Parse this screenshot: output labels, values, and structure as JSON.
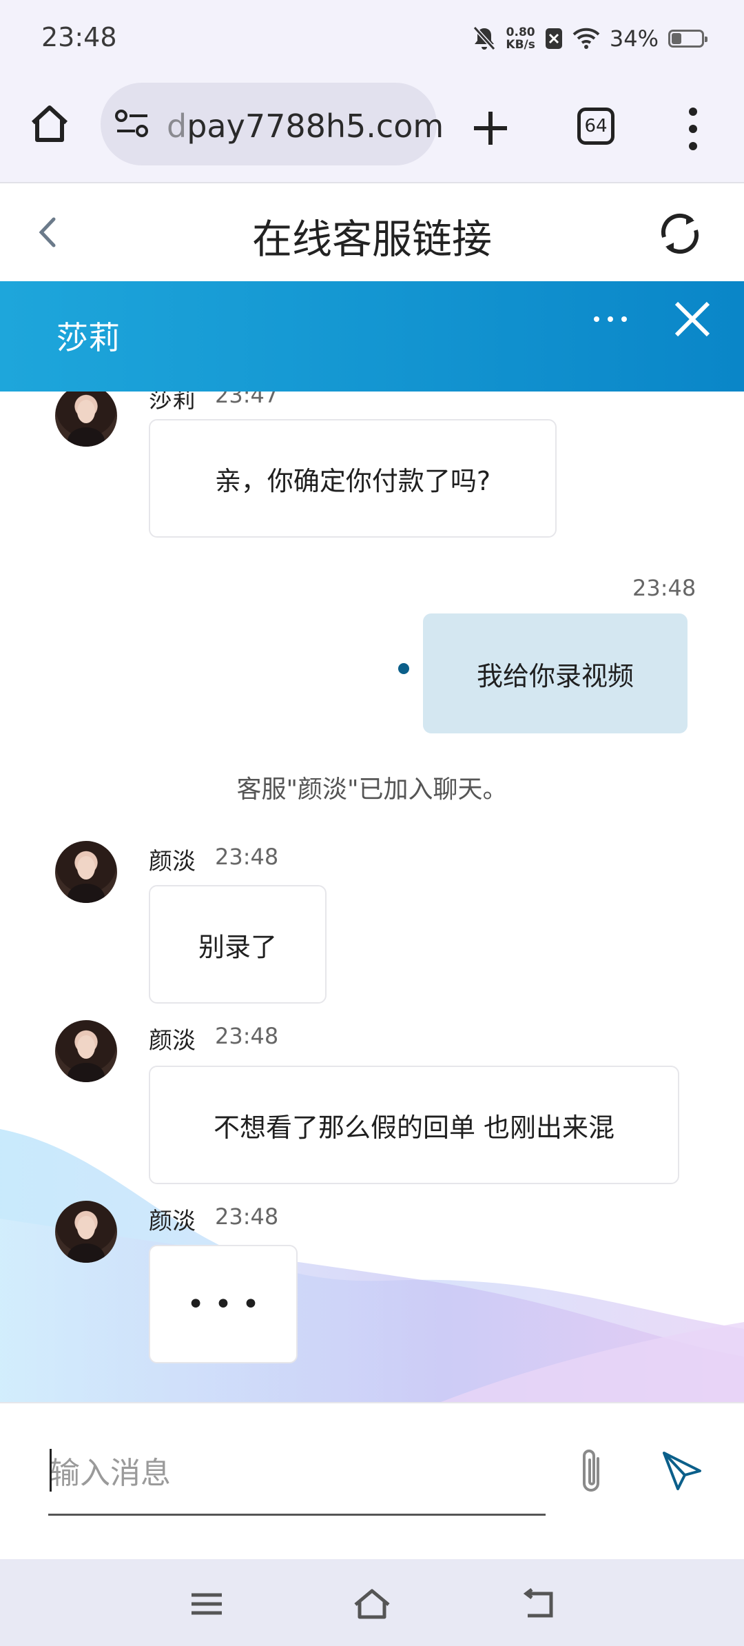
{
  "status_bar": {
    "time": "23:48",
    "net_speed_value": "0.80",
    "net_speed_unit": "KB/s",
    "battery": "34%"
  },
  "browser": {
    "url_fade": "d",
    "url": "pay7788h5.com",
    "tab_count": "64"
  },
  "page": {
    "title": "在线客服链接"
  },
  "chat_header": {
    "agent_name": "莎莉"
  },
  "messages": [
    {
      "sender": "莎莉",
      "time": "23:47",
      "text": "亲，你确定你付款了吗?"
    },
    {
      "sender": "me",
      "time": "23:48",
      "text": "我给你录视频"
    },
    {
      "system": "客服\"颜淡\"已加入聊天。"
    },
    {
      "sender": "颜淡",
      "time": "23:48",
      "text": "别录了"
    },
    {
      "sender": "颜淡",
      "time": "23:48",
      "text": "不想看了那么假的回单 也刚出来混"
    },
    {
      "sender": "颜淡",
      "time": "23:48",
      "text": "• • •"
    }
  ],
  "input": {
    "placeholder": "输入消息"
  },
  "icons": {
    "status": [
      "bell-off-icon",
      "close-box-icon",
      "wifi-icon",
      "battery-icon"
    ],
    "browser": [
      "home-icon",
      "site-settings-icon",
      "plus-icon",
      "tabs-icon",
      "more-vert-icon"
    ],
    "page": [
      "back-icon",
      "refresh-icon"
    ],
    "chat": [
      "more-horiz-icon",
      "close-icon",
      "attach-icon",
      "send-icon"
    ],
    "nav": [
      "menu-icon",
      "nav-home-icon",
      "nav-back-icon"
    ]
  },
  "colors": {
    "chat_header": "#0a86c8",
    "my_bubble": "#d4e7f1",
    "send_icon": "#0b5f8a"
  }
}
